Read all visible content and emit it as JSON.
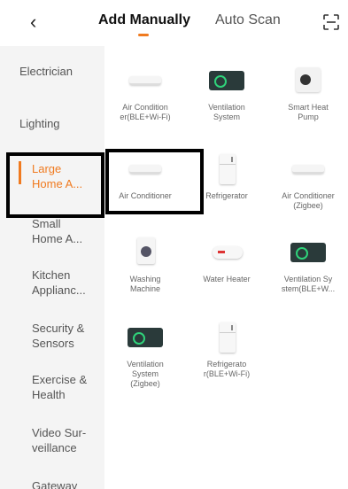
{
  "header": {
    "back_icon": "chevron-left-icon",
    "tab_active": "Add Manually",
    "tab_inactive": "Auto Scan",
    "scan_icon": "scan-icon",
    "accent_color": "#f07a1f"
  },
  "sidebar": {
    "items": [
      {
        "label": "Electrician"
      },
      {
        "label": "Lighting"
      },
      {
        "label": "Large\nHome A...",
        "active": true
      },
      {
        "label": "Small\nHome A..."
      },
      {
        "label": "Kitchen\nApplianc..."
      },
      {
        "label": "Security &\nSensors"
      },
      {
        "label": "Exercise &\nHealth"
      },
      {
        "label": "Video Sur-\nveillance"
      },
      {
        "label": "Gateway"
      }
    ]
  },
  "devices": [
    {
      "label": "Air Condition\ner(BLE+Wi-Fi)",
      "icon": "air-conditioner-icon"
    },
    {
      "label": "Ventilation\nSystem",
      "icon": "ventilation-icon"
    },
    {
      "label": "Smart Heat\nPump",
      "icon": "heat-pump-icon"
    },
    {
      "label": "Air Conditioner",
      "icon": "air-conditioner-icon"
    },
    {
      "label": "Refrigerator",
      "icon": "refrigerator-icon"
    },
    {
      "label": "Air Conditioner\n(Zigbee)",
      "icon": "air-conditioner-icon"
    },
    {
      "label": "Washing\nMachine",
      "icon": "washing-machine-icon"
    },
    {
      "label": "Water Heater",
      "icon": "water-heater-icon"
    },
    {
      "label": "Ventilation Sy\nstem(BLE+W...",
      "icon": "ventilation-icon"
    },
    {
      "label": "Ventilation\nSystem\n(Zigbee)",
      "icon": "ventilation-icon"
    },
    {
      "label": "Refrigerato\nr(BLE+Wi-Fi)",
      "icon": "refrigerator-icon"
    }
  ]
}
